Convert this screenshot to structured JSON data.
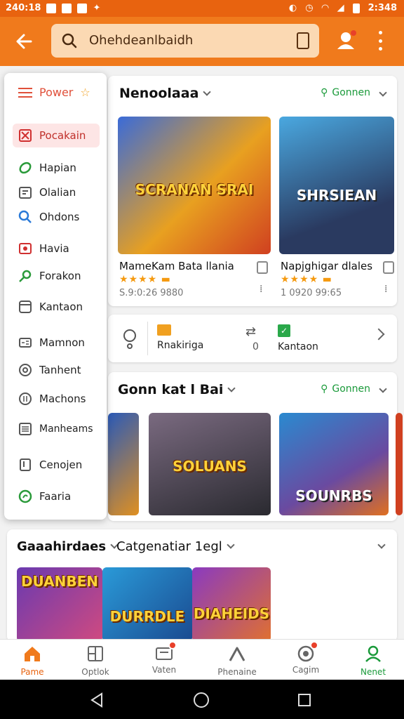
{
  "status_bar": {
    "time_left": "240:18",
    "time_right": "2:348"
  },
  "search": {
    "placeholder": "Ohehdeanlbaidh"
  },
  "drawer": {
    "title": "Power",
    "items": [
      {
        "label": "Pocakain",
        "icon": "package-icon",
        "selected": true
      },
      {
        "label": "Hapian",
        "icon": "leaf-icon"
      },
      {
        "label": "Olalian",
        "icon": "calendar-icon"
      },
      {
        "label": "Ohdons",
        "icon": "search-icon"
      },
      {
        "label": "Havia",
        "icon": "video-icon"
      },
      {
        "label": "Forakon",
        "icon": "key-icon"
      },
      {
        "label": "Kantaon",
        "icon": "folder-icon"
      },
      {
        "label": "Mamnon",
        "icon": "id-card-icon"
      },
      {
        "label": "Tanhent",
        "icon": "at-icon"
      },
      {
        "label": "Machons",
        "icon": "tag-icon"
      },
      {
        "label": "Manheams",
        "icon": "list-icon"
      },
      {
        "label": "Cenojen",
        "icon": "phone-icon"
      },
      {
        "label": "Faaria",
        "icon": "chat-icon"
      }
    ]
  },
  "section1": {
    "title": "Nenoolaaa",
    "link": "Gonnen",
    "games": [
      {
        "art": "SCRANAN SRAI",
        "name": "MameKam Bata llania",
        "meta": "S.9:0:26 9880",
        "rating": 4
      },
      {
        "art": "SHRSIEAN",
        "name": "Napjghigar dlales",
        "meta": "1 0920 99:65",
        "rating": 4
      }
    ],
    "actions": [
      {
        "label": "Rnakiriga"
      },
      {
        "label": "0"
      },
      {
        "label": "Kantaon"
      }
    ]
  },
  "section2": {
    "title": "Gonn kat l Bai",
    "link": "Gonnen",
    "tiles": [
      {
        "art": "SOLUANS"
      },
      {
        "art": "SOUNRBS"
      }
    ]
  },
  "section3": {
    "title_left": "Gaaahirdaes",
    "title_right": "Catgenatiar 1egl",
    "tiles": [
      {
        "art": "DUANBEN"
      },
      {
        "art": "DURRDLE"
      },
      {
        "art": "DIAHEIDS"
      }
    ]
  },
  "bottom_nav": [
    {
      "label": "Pame",
      "icon": "home-icon",
      "active": true
    },
    {
      "label": "Optlok",
      "icon": "grid-icon"
    },
    {
      "label": "Vaten",
      "icon": "cart-icon",
      "badge": true
    },
    {
      "label": "Phenaine",
      "icon": "person-icon"
    },
    {
      "label": "Cagim",
      "icon": "coin-icon",
      "badge": true
    },
    {
      "label": "Nenet",
      "icon": "profile-icon"
    }
  ],
  "colors": {
    "brand": "#f07a1c",
    "accent_green": "#1a9a3a",
    "badge": "#e8402a"
  }
}
